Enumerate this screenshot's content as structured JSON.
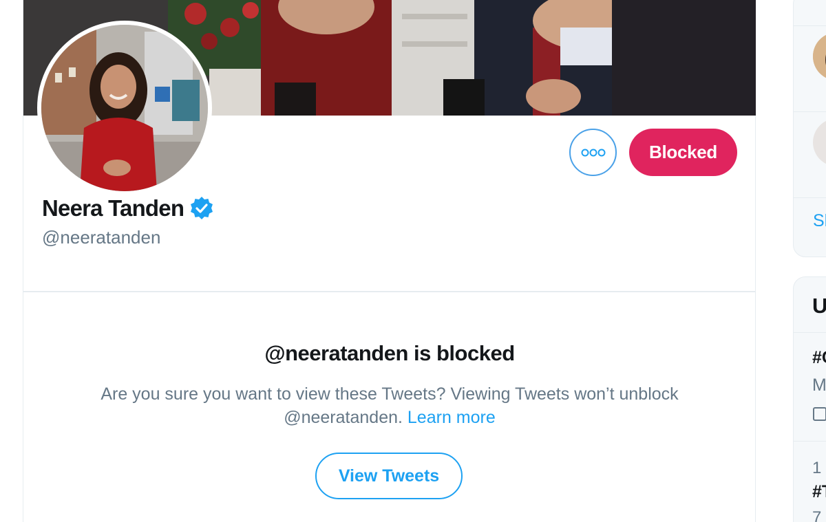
{
  "profile": {
    "display_name": "Neera Tanden",
    "handle": "@neeratanden",
    "verified": true,
    "blocked_label": "Blocked",
    "more_icon": "more-options-icon"
  },
  "blocked_notice": {
    "title": "@neeratanden is blocked",
    "description": "Are you sure you want to view these Tweets? Viewing Tweets won’t unblock @neeratanden.",
    "learn_more": "Learn more",
    "view_tweets_label": "View Tweets"
  },
  "sidebar": {
    "who_to_follow_show_more": "Sh",
    "trends": {
      "header": "U",
      "item1_tag": "#C",
      "item1_meta": "M",
      "item2_rank": "1",
      "item2_tag": "#T",
      "item2_count": "7"
    }
  },
  "colors": {
    "accent": "#1da1f2",
    "blocked_red": "#e0245e",
    "secondary_text": "#657786",
    "border": "#e6ecf0"
  }
}
